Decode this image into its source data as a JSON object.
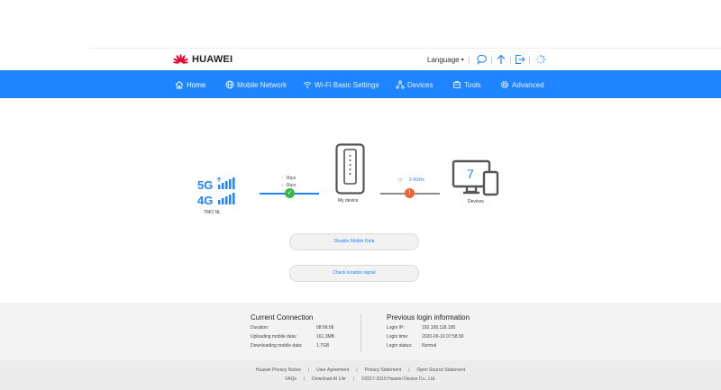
{
  "brand": {
    "name": "HUAWEI",
    "color": "#e4002b"
  },
  "header": {
    "language_label": "Language"
  },
  "colors": {
    "accent": "#1e84ff",
    "ok": "#3bb54a",
    "warn": "#f5622f"
  },
  "nav": {
    "items": [
      {
        "label": "Home",
        "icon": "home-icon"
      },
      {
        "label": "Mobile Network",
        "icon": "globe-icon"
      },
      {
        "label": "Wi-Fi Basic Settings",
        "icon": "wifi-icon"
      },
      {
        "label": "Devices",
        "icon": "devices-icon"
      },
      {
        "label": "Tools",
        "icon": "tools-icon"
      },
      {
        "label": "Advanced",
        "icon": "gear-icon"
      }
    ]
  },
  "diagram": {
    "network": {
      "type": "5G",
      "type2": "4G",
      "operator": "TMO NL"
    },
    "rates": {
      "up": "0bps",
      "down": "0bps"
    },
    "router_label": "My device",
    "wifi_band": "2.4GHz",
    "devices_count": "7",
    "devices_label": "Devices"
  },
  "actions": {
    "disable_mobile_data": "Disable Mobile Data",
    "check_location_signal": "Check location signal"
  },
  "current_connection": {
    "title": "Current Connection",
    "rows": [
      {
        "label": "Duration:",
        "value": "08:06:06"
      },
      {
        "label": "Uploading mobile data:",
        "value": "161.3MB"
      },
      {
        "label": "Downloading mobile data:",
        "value": "1.7GB"
      }
    ]
  },
  "previous_login": {
    "title": "Previous login information",
    "rows": [
      {
        "label": "Login IP:",
        "value": "192.168.118.195"
      },
      {
        "label": "Login time:",
        "value": "2020-09-19 07:58:30"
      },
      {
        "label": "Login status:",
        "value": "Normal"
      }
    ]
  },
  "footer": {
    "links": [
      "Huawei Privacy Notice",
      "User Agreement",
      "Privacy Statement",
      "Open Source Statement"
    ],
    "links2": [
      "FAQs",
      "Download AI Life"
    ],
    "copyright": "©2017-2019 Huawei Device Co., Ltd."
  }
}
